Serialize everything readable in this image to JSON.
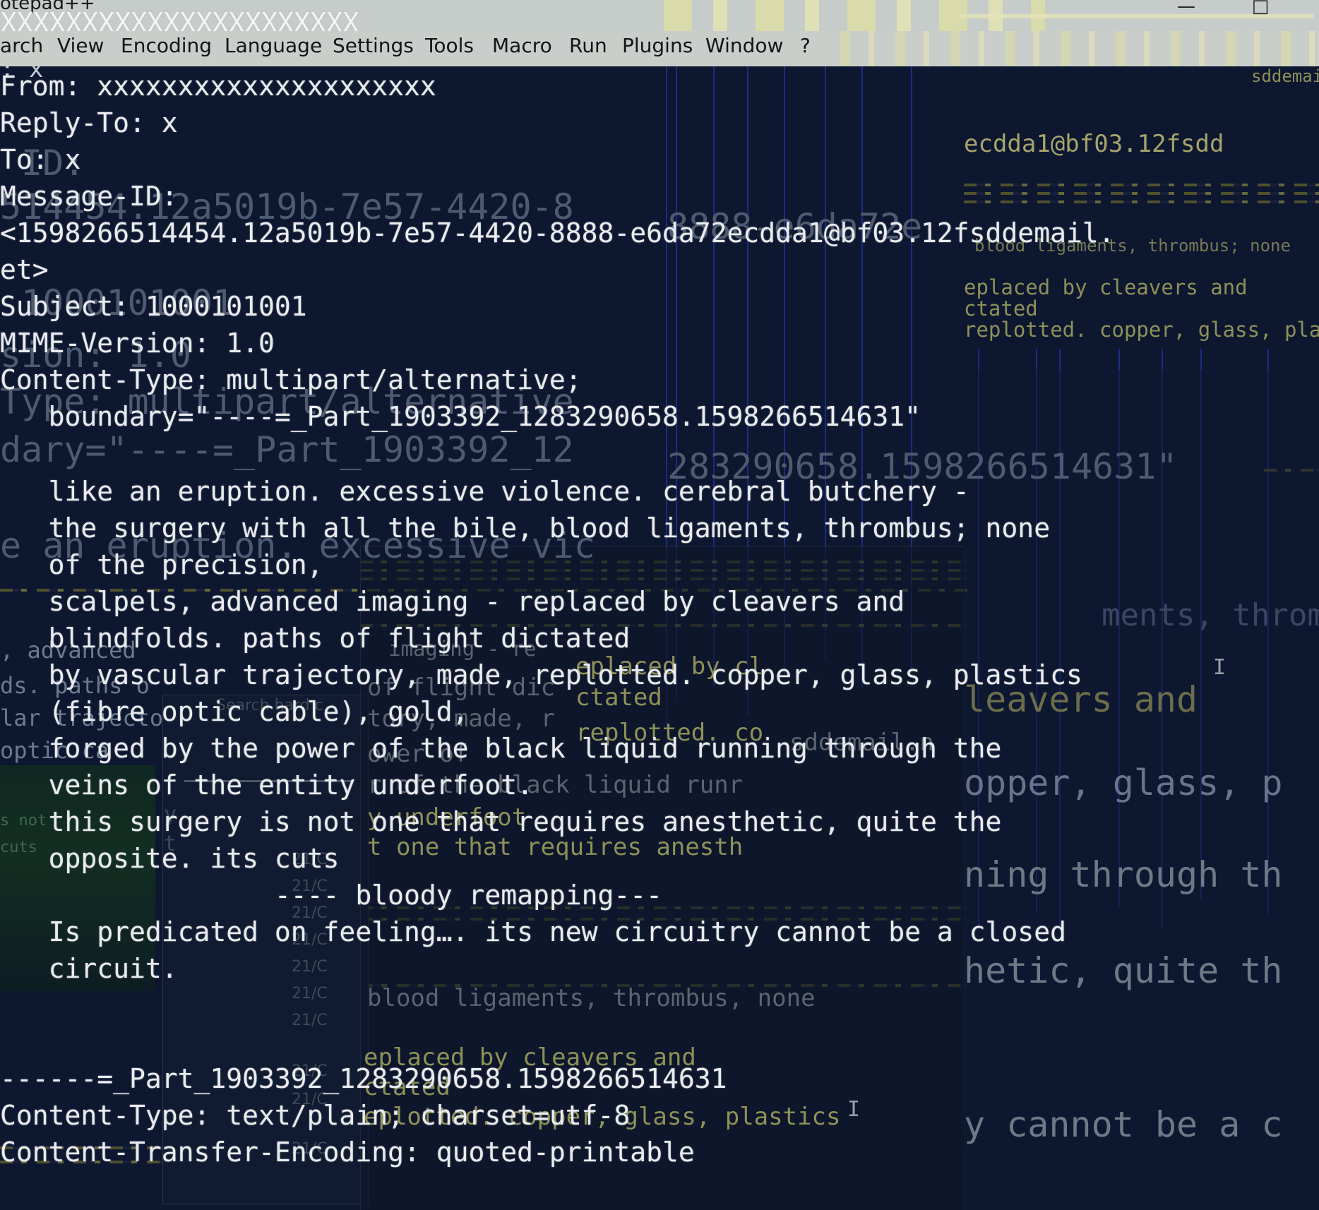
{
  "window": {
    "title": "otepad++",
    "title_overlay": "XXXXXXXXXXXXXXXXXXXXXX",
    "menu": [
      "arch",
      "View",
      "Encoding",
      "Language",
      "Settings",
      "Tools",
      "Macro",
      "Run",
      "Plugins",
      "Window",
      "?"
    ],
    "tab_fragment": ": x"
  },
  "email_lines": [
    "From: xxxxxxxxxxxxxxxxxxxxx",
    "Reply-To: x",
    "To: x",
    "Message-ID:",
    "<1598266514454.12a5019b-7e57-4420-8888-e6da72ecdda1@bf03.12fsddemail.",
    "et>",
    "Subject: 1000101001",
    "MIME-Version: 1.0",
    "Content-Type: multipart/alternative;",
    "   boundary=\"----=_Part_1903392_1283290658.1598266514631\"",
    "",
    "   like an eruption. excessive violence. cerebral butchery -",
    "   the surgery with all the bile, blood ligaments, thrombus; none",
    "   of the precision,",
    "   scalpels, advanced imaging - replaced by cleavers and",
    "   blindfolds. paths of flight dictated",
    "   by vascular trajectory, made, replotted. copper, glass, plastics",
    "   (fibre optic cable), gold,",
    "   forged by the power of the black liquid running through the",
    "   veins of the entity underfoot.",
    "   this surgery is not one that requires anesthetic, quite the",
    "   opposite. its cuts",
    "                 ---- bloody remapping---",
    "   Is predicated on feeling…. its new circuitry cannot be a closed",
    "   circuit.",
    "",
    "",
    "------=_Part_1903392_1283290658.1598266514631",
    "Content-Type: text/plain; charset=utf-8",
    "Content-Transfer-Encoding: quoted-printable"
  ],
  "ghost_layer": {
    "id_fragment": "ID:",
    "msgid_fragment": "514454.12a5019b-7e57-4420-8",
    "msgid_tail": "8888-e6da72e",
    "subject_fragment": "1000101001",
    "mime_fragment": "sion: 1.0",
    "type_fragment": "Type: multipart/alternative",
    "boundary_fragment": "dary=\"----=_Part_1903392_12",
    "boundary_tail": "283290658.1598266514631\"",
    "eruption_fragment": "e an eruption. excessive vic",
    "advanced_fragment": ", advanced",
    "paths_fragment": "ds. paths o",
    "trajectory_fragment": "lar trajecto",
    "optic_fragment": "optic ca",
    "not_fragment": "s not",
    "cuts_fragment": "cuts"
  },
  "right_layer": {
    "email_tail": "sddemai",
    "addr_fragment": "ecdda1@bf03.12fsdd",
    "strike_fragment": "blood ligaments, thrombus; none",
    "replaced_fragment": "eplaced by cleavers and",
    "dictated_fragment": "ctated",
    "replotted_fragment": "replotted. copper, glass, plastic",
    "cleavers_big": "leavers and",
    "ligaments_big": "ments, thrombus,",
    "copper_big": "opper, glass, p",
    "running_big": "ning through th",
    "anesthetic_big": "hetic, quite th",
    "cannot_big": "y cannot be a c"
  },
  "mid_layer": {
    "imaging_fragment": "imaging - re",
    "replaced_fragment": "eplaced by cl",
    "flight_fragment": "of flight dic",
    "dictated_fragment": "ctated",
    "tory_fragment": "tory, made, r",
    "replotted_fragment": "replotted. co",
    "email_fragment": "sddemail.n",
    "power_fragment": "ower of",
    "black_fragment": "r of the black liquid runr",
    "underfoot_fragment": "y underfoot",
    "anesthetic_fragment": "t one that requires anesth",
    "strike_fragment": "blood ligaments, thrombus, none",
    "replaced_low": "eplaced by cleavers and",
    "ctated_low": "ctated",
    "plastics_low": "eplotted. copper, glass, plastics"
  },
  "file_panel": {
    "search_placeholder": "Search hard c",
    "rows": [
      "21/C",
      "21/C",
      "21/C",
      "21/C",
      "21/C",
      "21/C",
      "21/C",
      "21/C",
      "21/C",
      "21/C"
    ],
    "left_fragment": "y",
    "t_fragment": "t"
  }
}
